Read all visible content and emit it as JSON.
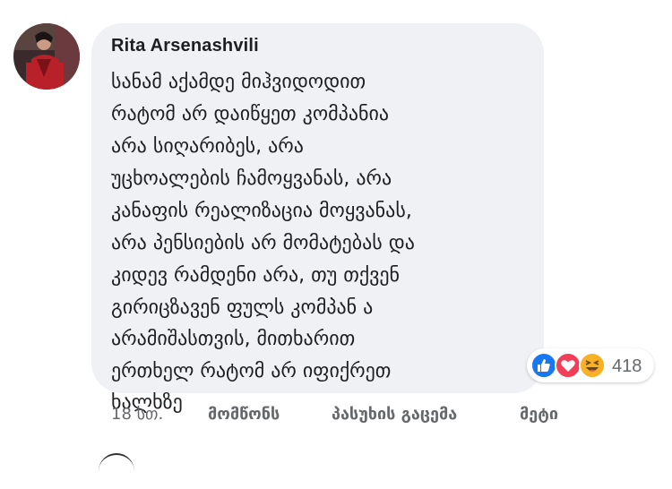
{
  "comment": {
    "author": "Rita Arsenashvili",
    "body_lines": [
      "სანამ აქამდე მიჰვიდოდით",
      "რატომ არ დაიწყეთ კომპანია",
      "არა სიღარიბეს, არა",
      "უცხოალების ჩამოყვანას, არა",
      "კანაფის რეალიზაცია მოყვანას,",
      "არა პენსიების არ მომატებას და",
      "კიდევ რამდენი არა, თუ თქვენ",
      "გირიცზავენ ფულს კომპან ა",
      "არამიშასთვის, მითხარით",
      "ერთხელ რატომ არ იფიქრეთ",
      "ხალხზე"
    ],
    "avatar_icon": "user-avatar-photo",
    "reactions": {
      "icons": [
        "like-icon",
        "love-icon",
        "haha-icon"
      ],
      "count": "418",
      "colors": {
        "like": "#1877f2",
        "love": "#f33e58",
        "haha": "#f7b125"
      }
    },
    "timestamp": "18 სთ.",
    "actions": {
      "like": "მომწონს",
      "reply": "პასუხის გაცემა",
      "more": "მეტი"
    }
  },
  "colors": {
    "bubble": "#f0f1f4",
    "text": "#1c1e21",
    "secondary_text": "#65676b"
  }
}
